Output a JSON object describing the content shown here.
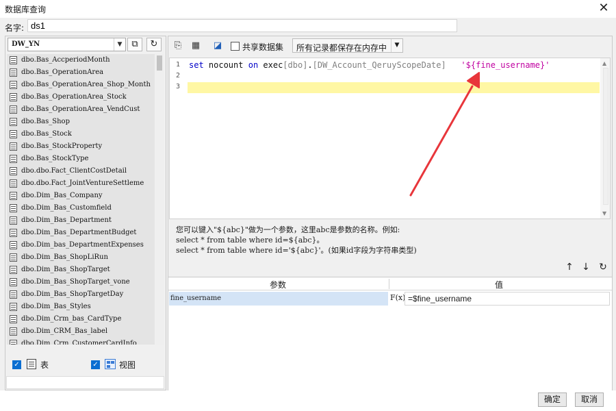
{
  "window": {
    "title": "数据库查询"
  },
  "name_field": {
    "label": "名字:",
    "value": "ds1"
  },
  "left_panel": {
    "db_select": "DW_YN",
    "tables": [
      "dbo.Bas_AccperiodMonth",
      "dbo.Bas_OperationArea",
      "dbo.Bas_OperationArea_Shop_Month",
      "dbo.Bas_OperationArea_Stock",
      "dbo.Bas_OperationArea_VendCust",
      "dbo.Bas_Shop",
      "dbo.Bas_Stock",
      "dbo.Bas_StockProperty",
      "dbo.Bas_StockType",
      "dbo.dbo.Fact_ClientCostDetail",
      "dbo.dbo.Fact_JointVentureSettleme",
      "dbo.Dim_Bas_Company",
      "dbo.Dim_Bas_Customfield",
      "dbo.Dim_Bas_Department",
      "dbo.Dim_Bas_DepartmentBudget",
      "dbo.Dim_bas_DepartmentExpenses",
      "dbo.Dim_Bas_ShopLiRun",
      "dbo.Dim_Bas_ShopTarget",
      "dbo.Dim_Bas_ShopTarget_vone",
      "dbo.Dim_Bas_ShopTargetDay",
      "dbo.Dim_Bas_Styles",
      "dbo.Dim_Crm_bas_CardType",
      "dbo.Dim_CRM_Bas_label",
      "dbo.Dim_Crm_CustomerCardInfo"
    ],
    "show_tables_label": "表",
    "show_views_label": "视图"
  },
  "toolbar": {
    "share_label": "共享数据集",
    "memory_option": "所有记录都保存在内存中"
  },
  "editor": {
    "line_numbers": [
      "1",
      "2",
      "3"
    ],
    "line1": {
      "kw_set": "set",
      "t_nocount": " nocount ",
      "kw_on": "on",
      "t_exec": " exec",
      "g_dbo": "[dbo]",
      "t_dot": ".",
      "g_proc": "[DW_Account_QeruyScopeDate]",
      "t_space": "   ",
      "s_param": "'${fine_username}'"
    }
  },
  "help": {
    "line1": "您可以键入\"${abc}\"做为一个参数，这里abc是参数的名称。例如:",
    "line2": "select * from table where id=${abc}。",
    "line3": "select * from table where id='${abc}'。(如果id字段为字符串类型)"
  },
  "params": {
    "header_name": "参数",
    "header_value": "值",
    "rows": [
      {
        "name": "fine_username",
        "fx": "F(x)",
        "value": "=$fine_username"
      }
    ]
  },
  "buttons": {
    "ok": "确定",
    "cancel": "取消"
  },
  "colors": {
    "arrow": "#e8363b",
    "highlight": "#fff7a4",
    "keyword": "#0000c8",
    "string": "#c000a0",
    "selection": "#d4e4f6"
  }
}
